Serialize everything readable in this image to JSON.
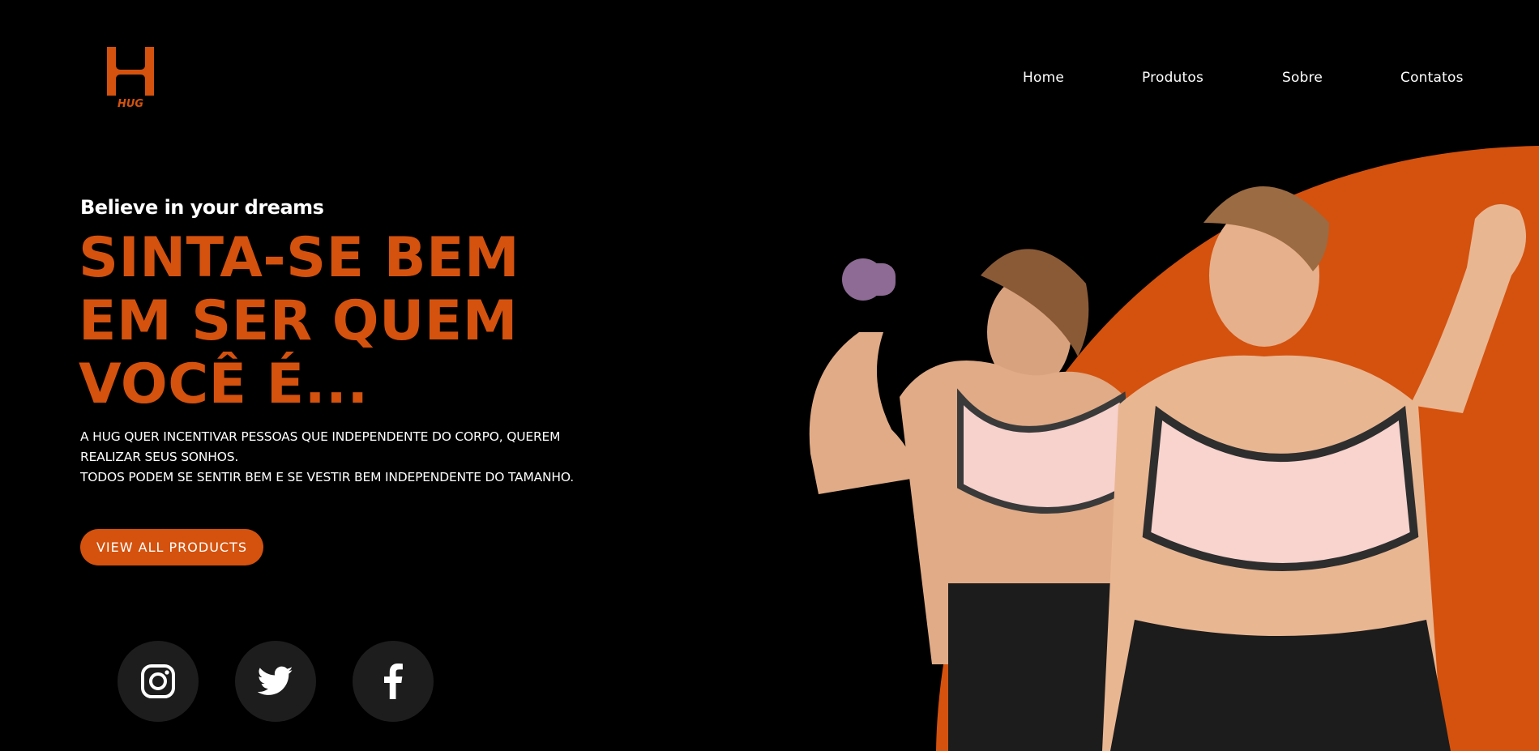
{
  "header": {
    "logo_text": "HUG",
    "nav": [
      {
        "label": "Home"
      },
      {
        "label": "Produtos"
      },
      {
        "label": "Sobre"
      },
      {
        "label": "Contatos"
      }
    ]
  },
  "hero": {
    "tagline": "Believe in your dreams",
    "headline": [
      "SINTA-SE BEM",
      "EM SER QUEM",
      "VOCÊ É..."
    ],
    "description": [
      "A HUG QUER INCENTIVAR PESSOAS QUE INDEPENDENTE DO CORPO, QUEREM",
      "REALIZAR SEUS SONHOS.",
      "TODOS PODEM SE SENTIR BEM E SE VESTIR BEM INDEPENDENTE DO TAMANHO."
    ],
    "cta_label": "VIEW ALL PRODUCTS"
  },
  "social": [
    {
      "icon": "instagram-icon"
    },
    {
      "icon": "twitter-icon"
    },
    {
      "icon": "facebook-icon"
    }
  ],
  "colors": {
    "accent": "#d4520e",
    "background": "#000000",
    "social_bg": "#1d1d1d"
  }
}
